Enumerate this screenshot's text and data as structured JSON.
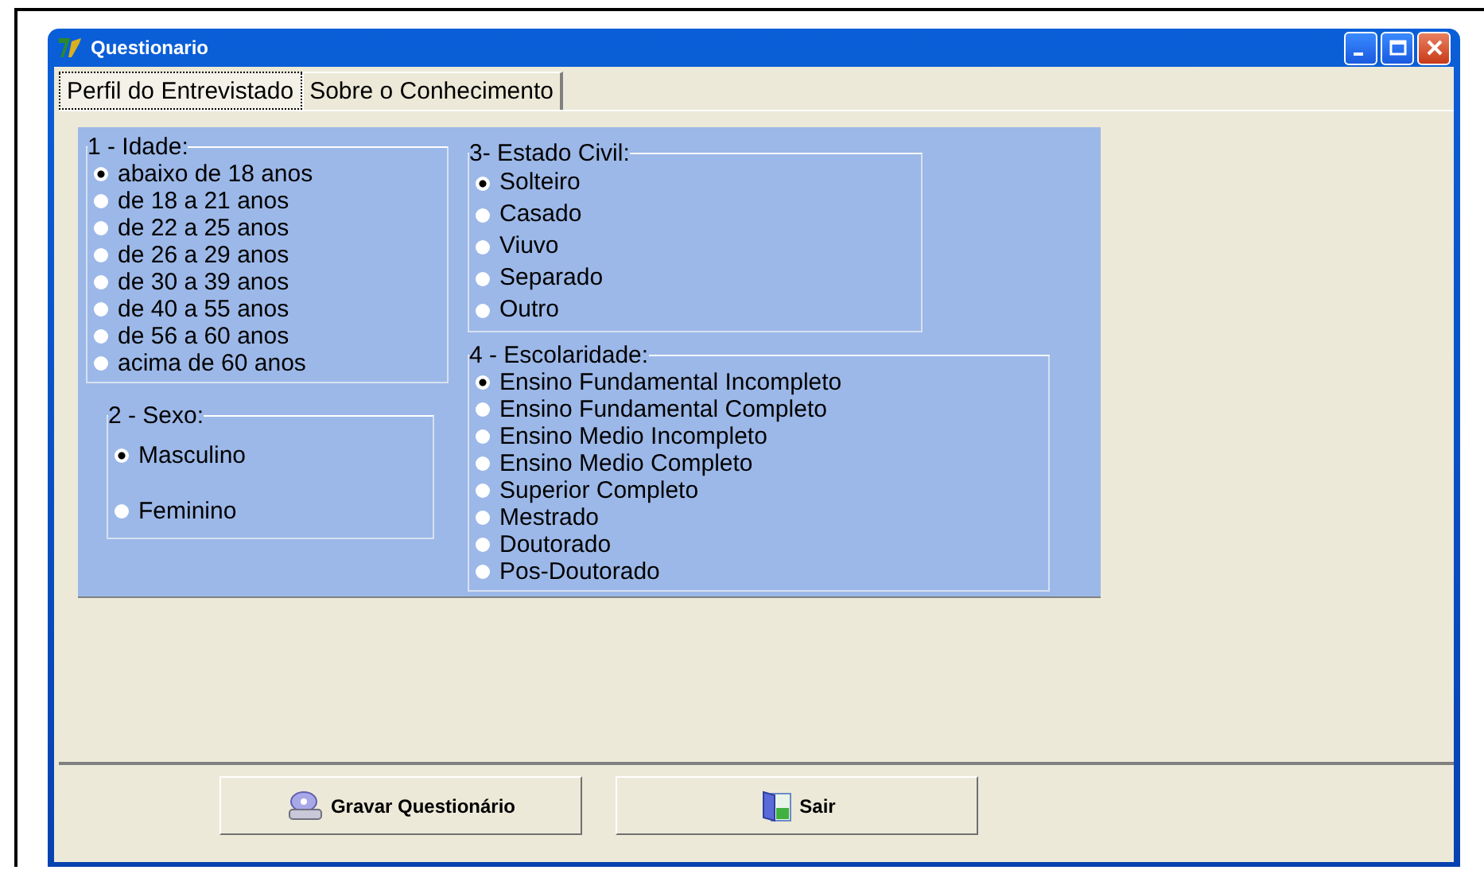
{
  "window": {
    "title": "Questionario"
  },
  "tabs": [
    {
      "label": "Perfil do Entrevistado",
      "selected": true
    },
    {
      "label": "Sobre o Conhecimento",
      "selected": false
    }
  ],
  "groups": [
    {
      "title": "1 - Idade:",
      "options": [
        {
          "label": "abaixo de 18 anos",
          "selected": true
        },
        {
          "label": "de 18 a 21 anos",
          "selected": false
        },
        {
          "label": "de 22 a 25 anos",
          "selected": false
        },
        {
          "label": "de 26 a 29 anos",
          "selected": false
        },
        {
          "label": "de 30 a 39 anos",
          "selected": false
        },
        {
          "label": "de 40 a 55 anos",
          "selected": false
        },
        {
          "label": "de 56 a 60 anos",
          "selected": false
        },
        {
          "label": "acima de 60 anos",
          "selected": false
        }
      ]
    },
    {
      "title": "2 - Sexo:",
      "options": [
        {
          "label": "Masculino",
          "selected": true
        },
        {
          "label": "Feminino",
          "selected": false
        }
      ]
    },
    {
      "title": "3- Estado Civil:",
      "options": [
        {
          "label": "Solteiro",
          "selected": true
        },
        {
          "label": "Casado",
          "selected": false
        },
        {
          "label": "Viuvo",
          "selected": false
        },
        {
          "label": "Separado",
          "selected": false
        },
        {
          "label": "Outro",
          "selected": false
        }
      ]
    },
    {
      "title": "4 - Escolaridade:",
      "options": [
        {
          "label": "Ensino Fundamental Incompleto",
          "selected": true
        },
        {
          "label": "Ensino Fundamental Completo",
          "selected": false
        },
        {
          "label": "Ensino Medio Incompleto",
          "selected": false
        },
        {
          "label": "Ensino Medio Completo",
          "selected": false
        },
        {
          "label": "Superior Completo",
          "selected": false
        },
        {
          "label": "Mestrado",
          "selected": false
        },
        {
          "label": "Doutorado",
          "selected": false
        },
        {
          "label": "Pos-Doutorado",
          "selected": false
        }
      ]
    }
  ],
  "buttons": [
    {
      "label": "Gravar Questionário",
      "kind": "save"
    },
    {
      "label": "Sair",
      "kind": "exit"
    }
  ]
}
